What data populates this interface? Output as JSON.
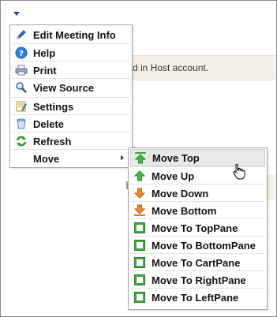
{
  "background": {
    "host_text": "d in Host account."
  },
  "menu": {
    "items": [
      {
        "label": "Edit Meeting Info",
        "icon": "pencil-icon"
      },
      {
        "label": "Help",
        "icon": "help-icon"
      },
      {
        "label": "Print",
        "icon": "printer-icon"
      },
      {
        "label": "View Source",
        "icon": "magnifier-icon"
      },
      {
        "label": "Settings",
        "icon": "settings-icon"
      },
      {
        "label": "Delete",
        "icon": "trash-icon"
      },
      {
        "label": "Refresh",
        "icon": "refresh-icon"
      },
      {
        "label": "Move",
        "icon": ""
      }
    ]
  },
  "submenu": {
    "items": [
      {
        "label": "Move Top",
        "icon": "arrow-up-top-icon"
      },
      {
        "label": "Move Up",
        "icon": "arrow-up-icon"
      },
      {
        "label": "Move Down",
        "icon": "arrow-down-icon"
      },
      {
        "label": "Move Bottom",
        "icon": "arrow-down-bottom-icon"
      },
      {
        "label": "Move To TopPane",
        "icon": "pane-icon"
      },
      {
        "label": "Move To BottomPane",
        "icon": "pane-icon"
      },
      {
        "label": "Move To CartPane",
        "icon": "pane-icon"
      },
      {
        "label": "Move To RightPane",
        "icon": "pane-icon"
      },
      {
        "label": "Move To LeftPane",
        "icon": "pane-icon"
      }
    ]
  },
  "colors": {
    "accent": "#1f3f8f",
    "green": "#3aa53a",
    "orange": "#e07a1a"
  }
}
